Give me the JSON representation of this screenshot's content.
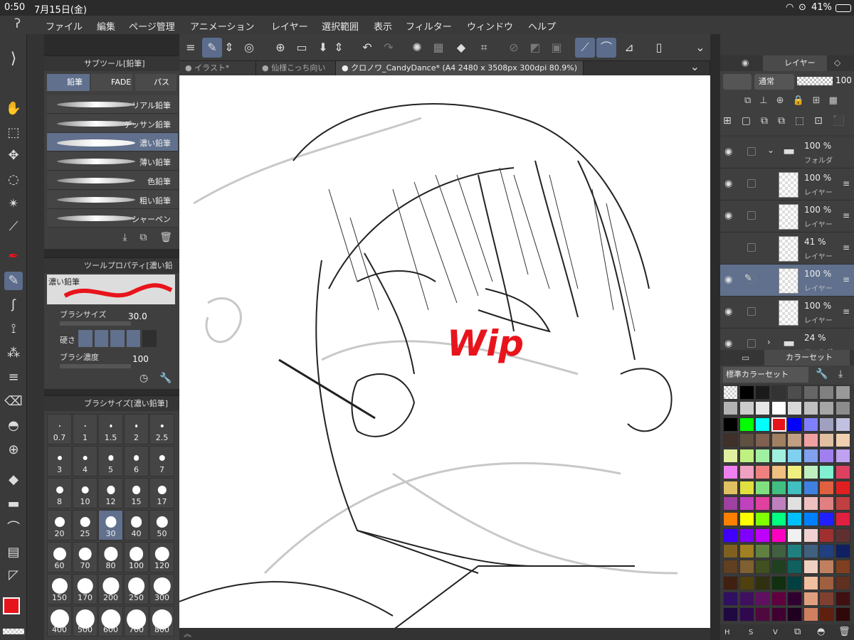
{
  "status": {
    "time": "0:50",
    "date": "7月15日(金)",
    "battery": "41%"
  },
  "menu": [
    "ファイル",
    "編集",
    "ページ管理",
    "アニメーション",
    "レイヤー",
    "選択範囲",
    "表示",
    "フィルター",
    "ウィンドウ",
    "ヘルプ"
  ],
  "tabs": [
    "イラスト*",
    "仙様こっち向い",
    "クロノワ_CandyDance* (A4 2480 x 3508px 300dpi 80.9%)"
  ],
  "subtool": {
    "title": "サブツール[鉛筆]",
    "groups": [
      "鉛筆",
      "FADE",
      "パステ"
    ],
    "brushes": [
      "リアル鉛筆",
      "デッサン鉛筆",
      "濃い鉛筆",
      "薄い鉛筆",
      "色鉛筆",
      "粗い鉛筆",
      "シャーペン"
    ],
    "selected_index": 2
  },
  "toolprop": {
    "title": "ツールプロパティ[濃い鉛",
    "brush_name": "濃い鉛筆",
    "size_label": "ブラシサイズ",
    "size_value": "30.0",
    "hardness_label": "硬さ",
    "density_label": "ブラシ濃度",
    "density_value": "100"
  },
  "brushsize": {
    "title": "ブラシサイズ[濃い鉛筆]",
    "sizes": [
      "0.7",
      "1",
      "1.5",
      "2",
      "2.5",
      "3",
      "4",
      "5",
      "6",
      "7",
      "8",
      "10",
      "12",
      "15",
      "17",
      "20",
      "25",
      "30",
      "40",
      "50",
      "60",
      "70",
      "80",
      "100",
      "120",
      "150",
      "170",
      "200",
      "250",
      "300",
      "400",
      "500",
      "600",
      "700",
      "800"
    ],
    "selected": "30"
  },
  "canvas": {
    "wip_text": "Wip",
    "wip_color": "#e8141c"
  },
  "layers": {
    "title": "レイヤー",
    "blend_mode": "通常",
    "opacity": "100",
    "rows": [
      {
        "pct": "100 %",
        "name": "フォルダ",
        "type": "folder"
      },
      {
        "pct": "100 %",
        "name": "レイヤー",
        "type": "layer"
      },
      {
        "pct": "100 %",
        "name": "レイヤー",
        "type": "layer"
      },
      {
        "pct": "41 %",
        "name": "レイヤー",
        "type": "layer"
      },
      {
        "pct": "100 %",
        "name": "レイヤー",
        "type": "layer"
      },
      {
        "pct": "100 %",
        "name": "レイヤー",
        "type": "layer"
      },
      {
        "pct": "24 %",
        "name": "フォルダ",
        "type": "folder"
      }
    ],
    "selected_index": 4
  },
  "colorset": {
    "title": "カラーセット",
    "set_name": "標準カラーセット",
    "bottom_labels": [
      "H",
      "S",
      "V"
    ]
  },
  "colors": {
    "main": "#e8141c",
    "sub": "#ffffff",
    "accent": "#60708d"
  }
}
